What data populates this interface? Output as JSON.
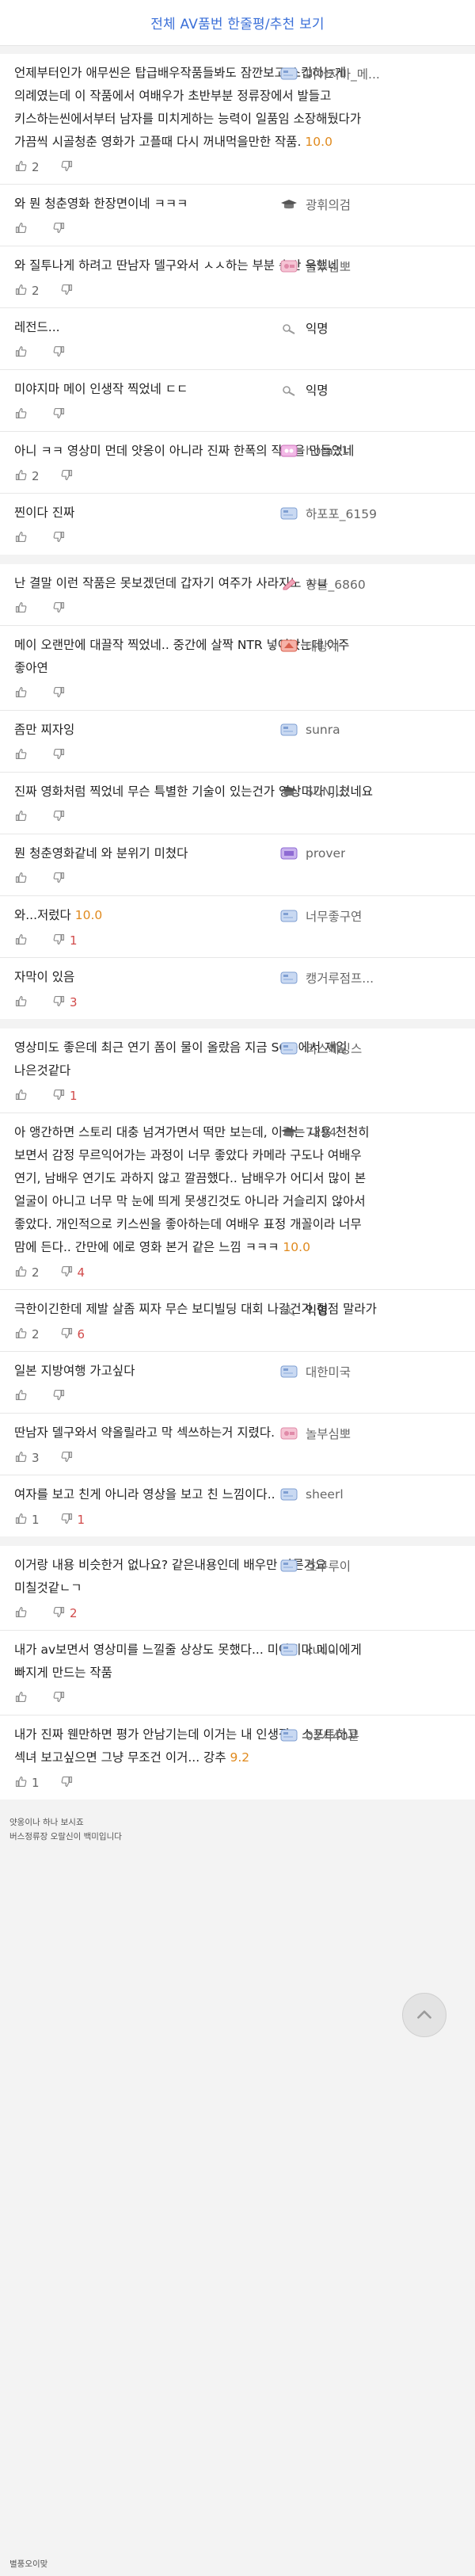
{
  "header": {
    "title": "전체 AV품번 한줄평/추천 보기"
  },
  "sections": [
    {
      "comments": [
        {
          "text": "언제부터인가 애무씬은 탑급배우작품들봐도 잠깐보고 스킵하는게 의례였는데 이 작품에서 여배우가 초반부분 정류장에서 발들고 키스하는씬에서부터 남자를 미치게하는 능력이 일품임 소장해뒀다가 가끔씩 시골청춘 영화가 고플때 다시 꺼내먹을만한 작품.",
          "score": "10.0",
          "up": "2",
          "down": "",
          "author": "미야지마_메...",
          "badge": "blue"
        },
        {
          "text": "와 뭔 청춘영화 한장면이네 ㅋㅋㅋ",
          "score": "",
          "up": "",
          "down": "",
          "author": "광휘의검",
          "badge": "grad"
        },
        {
          "text": "와 질투나게 하려고 딴남자 델구와서 ㅅㅅ하는 부분 순간 욱했네",
          "score": "",
          "up": "2",
          "down": "",
          "author": "놀부심뽀",
          "badge": "pink"
        },
        {
          "text": "레전드...",
          "score": "",
          "up": "",
          "down": "",
          "author": "익명",
          "badge": "anon"
        },
        {
          "text": "미야지마 메이 인생작 찍었네 ㄷㄷ",
          "score": "",
          "up": "",
          "down": "",
          "author": "익명",
          "badge": "anon"
        },
        {
          "text": "아니 ㅋㅋ 영상미 먼데 얏옹이 아니라 진짜 한폭의 작품을 만들었네",
          "score": "",
          "up": "2",
          "down": "",
          "author": "hora31",
          "badge": "pinkq"
        },
        {
          "text": "찐이다 진짜",
          "score": "",
          "up": "",
          "down": "",
          "author": "하포포_6159",
          "badge": "blue"
        }
      ]
    },
    {
      "comments": [
        {
          "text": "난 결말 이런 작품은 못보겠던데 갑자기 여주가 사라지노 ㅅㅂ",
          "score": "",
          "up": "",
          "down": "",
          "author": "향불_6860",
          "badge": "pencil"
        },
        {
          "text": "메이 오랜만에 대끌작 찍었네.. 중간에 살짝 NTR 넣어놨는데 아주 좋아연",
          "score": "",
          "up": "",
          "down": "",
          "author": "태랑계",
          "badge": "red"
        },
        {
          "text": "좀만 찌자잉",
          "score": "",
          "up": "",
          "down": "",
          "author": "sunra",
          "badge": "blue"
        },
        {
          "text": "진짜 영화처럼 찍었네 무슨 특별한 기술이 있는건가 영상미가 미쳤네요",
          "score": "",
          "up": "",
          "down": "",
          "author": "SUNJU",
          "badge": "grad"
        },
        {
          "text": "뭔 청춘영화같네 와 분위기 미쳤다",
          "score": "",
          "up": "",
          "down": "",
          "author": "prover",
          "badge": "purple"
        },
        {
          "text": "와...저렀다",
          "score": "10.0",
          "up": "",
          "down": "1",
          "author": "너무좋구연",
          "badge": "blue"
        },
        {
          "text": "자막이 있음",
          "score": "",
          "up": "",
          "down": "3",
          "author": "캥거루점프...",
          "badge": "blue"
        }
      ]
    },
    {
      "comments": [
        {
          "text": "영상미도 좋은데 최근 연기 폼이 물이 올랐음 지금 SOD에서 제일 나은것같다",
          "score": "",
          "up": "",
          "down": "1",
          "author": "리스케잉스",
          "badge": "blue"
        },
        {
          "text": "아 앵간하면 스토리 대충 넘겨가면서 떡만 보는데, 이거는 내용 천천히 보면서 감정 무르익어가는 과정이 너무 좋았다 카메라 구도나 여배우 연기, 남배우 연기도 과하지 않고 깔끔했다.. 남배우가 어디서 많이 본 얼굴이 아니고 너무 막 눈에 띄게 못생긴것도 아니라 거슬리지 않아서 좋았다. 개인적으로 키스씬을 좋아하는데 여배우 표정 개꼴이라 너무 맘에 든다.. 간만에 에로 영화 본거 같은 느낌 ㅋㅋㅋ",
          "score": "10.0",
          "up": "2",
          "down": "4",
          "author": "7294",
          "badge": "grad"
        },
        {
          "text": "극한이긴한데 제발 살좀 찌자 무슨 보디빌딩 대회 나갈건가 점점 말라가",
          "score": "",
          "up": "2",
          "down": "6",
          "author": "익명",
          "badge": "anon"
        },
        {
          "text": "일본 지방여행 가고싶다",
          "score": "",
          "up": "",
          "down": "",
          "author": "대한미국",
          "badge": "blue"
        },
        {
          "text": "딴남자 델구와서 약올릴라고 막 섹쓰하는거 지렸다.",
          "score": "",
          "up": "3",
          "down": "",
          "author": "놀부심뽀",
          "badge": "pink"
        },
        {
          "text": "여자를 보고 친게 아니라 영상을 보고 친 느낌이다..",
          "score": "",
          "up": "1",
          "down": "1",
          "author": "sheerl",
          "badge": "blue"
        }
      ]
    },
    {
      "comments": [
        {
          "text": "이거랑 내용 비슷한거 없나요? 같은내용인데 배우만 다른거요 미칠것같ㄴㄱ",
          "score": "",
          "up": "",
          "down": "2",
          "author": "호쿠루이",
          "badge": "blue"
        },
        {
          "text": "내가 av보면서 영상미를 느낄줄 상상도 못했다... 미야지마 메이에게 빠지게 만드는 작품",
          "score": "",
          "up": "",
          "down": "",
          "author": "kuuu",
          "badge": "blue"
        },
        {
          "text": "내가 진짜 웬만하면 평가 안남기는데 이거는 내 인생작.. 소프트하고 섹녀 보고싶으면 그냥 무조건 이거... 강추",
          "score": "9.2",
          "up": "1",
          "down": "",
          "author": "02시40분",
          "badge": "blue"
        }
      ]
    }
  ],
  "footer": {
    "lines": [
      "얏옹이나 하나 보시죠",
      "버스정류장 오랄신이 백미입니다"
    ],
    "bottom": "별풍오이맞"
  },
  "icons": {
    "thumbs_up": "thumbs-up-icon",
    "thumbs_down": "thumbs-down-icon",
    "scroll_top": "chevron-up-icon"
  },
  "colors": {
    "link": "#3a6fd8",
    "score": "#e08a1e",
    "downvote": "#d14a4a"
  }
}
